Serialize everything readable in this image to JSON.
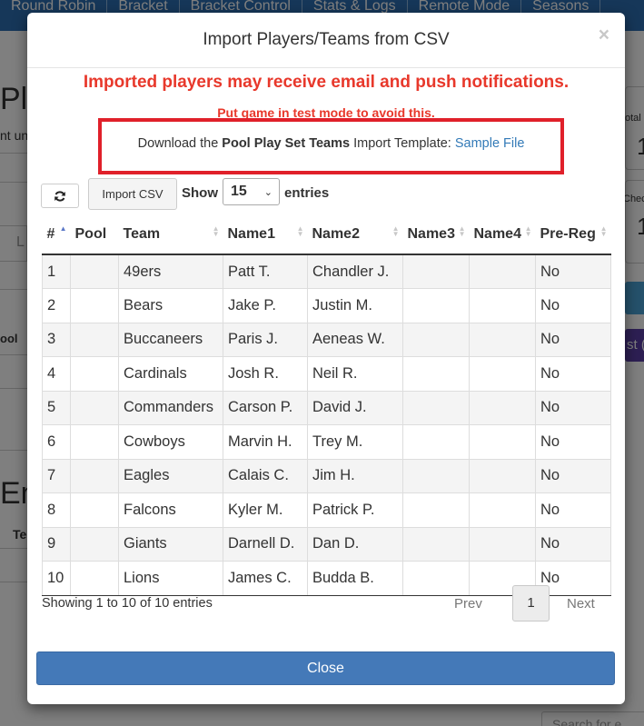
{
  "background": {
    "nav": [
      "Round Robin",
      "Bracket",
      "Bracket Control",
      "Stats & Logs",
      "Remote Mode",
      "Seasons"
    ],
    "fragments": {
      "pl": "Pl",
      "nt_un": "nt un",
      "l": "L",
      "ool": "ool",
      "em": "Em",
      "te": "Te",
      "otal": "otal",
      "one": "1",
      "chec": "Chec",
      "one2": "1",
      "st": "st (",
      "search": "Search for e"
    }
  },
  "modal": {
    "title": "Import Players/Teams from CSV",
    "close_x": "×",
    "warning_main": "Imported players may receive email and push notifications.",
    "warning_sub": "Put game in test mode to avoid this.",
    "template": {
      "prefix": "Download the ",
      "name": "Pool Play Set Teams",
      "middle": " Import Template: ",
      "link": "Sample File"
    },
    "toolbar": {
      "import_label": "Import CSV",
      "show_label": "Show",
      "page_size": "15",
      "entries_label": "entries"
    },
    "table": {
      "columns": [
        "#",
        "Pool",
        "Team",
        "Name1",
        "Name2",
        "Name3",
        "Name4",
        "Pre-Reg"
      ],
      "rows": [
        [
          "1",
          "",
          "49ers",
          "Patt T.",
          "Chandler J.",
          "",
          "",
          "No"
        ],
        [
          "2",
          "",
          "Bears",
          "Jake P.",
          "Justin M.",
          "",
          "",
          "No"
        ],
        [
          "3",
          "",
          "Buccaneers",
          "Paris J.",
          "Aeneas W.",
          "",
          "",
          "No"
        ],
        [
          "4",
          "",
          "Cardinals",
          "Josh R.",
          "Neil R.",
          "",
          "",
          "No"
        ],
        [
          "5",
          "",
          "Commanders",
          "Carson P.",
          "David J.",
          "",
          "",
          "No"
        ],
        [
          "6",
          "",
          "Cowboys",
          "Marvin H.",
          "Trey M.",
          "",
          "",
          "No"
        ],
        [
          "7",
          "",
          "Eagles",
          "Calais C.",
          "Jim H.",
          "",
          "",
          "No"
        ],
        [
          "8",
          "",
          "Falcons",
          "Kyler M.",
          "Patrick P.",
          "",
          "",
          "No"
        ],
        [
          "9",
          "",
          "Giants",
          "Darnell D.",
          "Dan D.",
          "",
          "",
          "No"
        ],
        [
          "10",
          "",
          "Lions",
          "James C.",
          "Budda B.",
          "",
          "",
          "No"
        ]
      ]
    },
    "info": "Showing 1 to 10 of 10 entries",
    "pagination": {
      "prev": "Prev",
      "current": "1",
      "next": "Next"
    },
    "close_button": "Close"
  }
}
